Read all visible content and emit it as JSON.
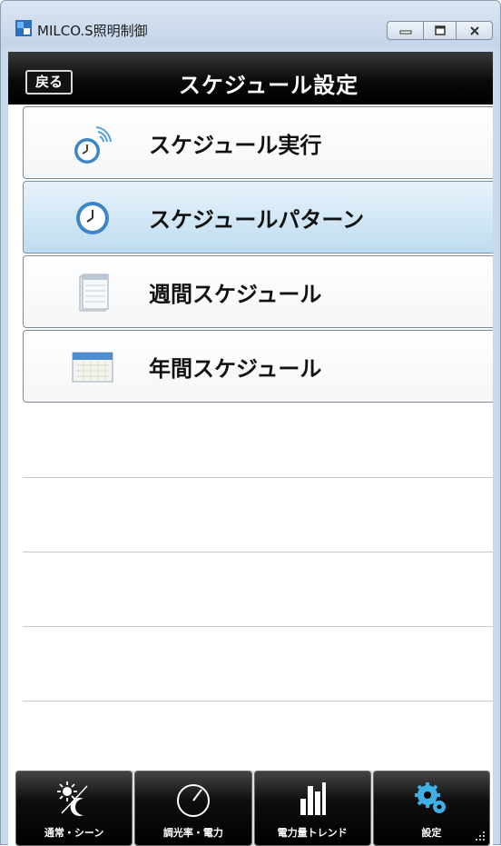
{
  "window": {
    "title": "MILCO.S照明制御",
    "minimize_icon": "minimize-icon",
    "maximize_icon": "maximize-icon",
    "close_icon": "close-icon"
  },
  "header": {
    "back_label": "戻る",
    "title": "スケジュール設定"
  },
  "menu": {
    "items": [
      {
        "label": "スケジュール実行",
        "icon": "schedule-run-clock-icon",
        "selected": false
      },
      {
        "label": "スケジュールパターン",
        "icon": "clock-icon",
        "selected": true
      },
      {
        "label": "週間スケジュール",
        "icon": "weekly-calendar-icon",
        "selected": false
      },
      {
        "label": "年間スケジュール",
        "icon": "yearly-calendar-icon",
        "selected": false
      }
    ]
  },
  "footer": {
    "tabs": [
      {
        "label": "通常・シーン",
        "icon": "sun-moon-icon"
      },
      {
        "label": "調光率・電力",
        "icon": "dial-gauge-icon"
      },
      {
        "label": "電力量トレンド",
        "icon": "bar-chart-icon"
      },
      {
        "label": "設定",
        "icon": "gear-icon"
      }
    ]
  },
  "colors": {
    "header_bg": "#000000",
    "selected_item_bg": "#cfe6f6",
    "titlebar_bg": "#c9d9ec"
  }
}
